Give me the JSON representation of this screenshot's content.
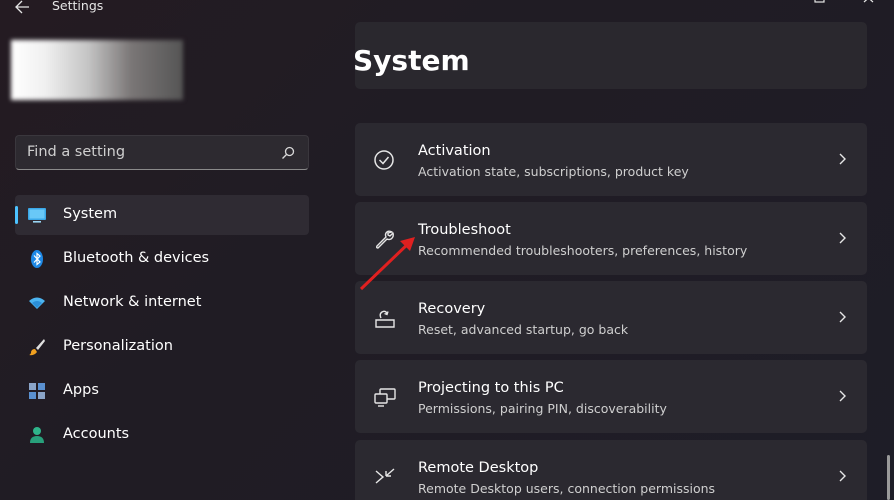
{
  "window": {
    "title": "Settings",
    "back_icon": "arrow-left-icon",
    "controls": [
      "restore-icon",
      "close-icon"
    ]
  },
  "search": {
    "placeholder": "Find a setting",
    "icon": "search-icon"
  },
  "sidebar": {
    "items": [
      {
        "label": "System",
        "icon": "monitor-icon",
        "active": true
      },
      {
        "label": "Bluetooth & devices",
        "icon": "bluetooth-icon"
      },
      {
        "label": "Network & internet",
        "icon": "wifi-icon"
      },
      {
        "label": "Personalization",
        "icon": "brush-icon"
      },
      {
        "label": "Apps",
        "icon": "apps-icon"
      },
      {
        "label": "Accounts",
        "icon": "person-icon"
      }
    ]
  },
  "main": {
    "title": "System",
    "cards": [
      {
        "title": "Activation",
        "desc": "Activation state, subscriptions, product key",
        "icon": "check-circle-icon"
      },
      {
        "title": "Troubleshoot",
        "desc": "Recommended troubleshooters, preferences, history",
        "icon": "wrench-icon"
      },
      {
        "title": "Recovery",
        "desc": "Reset, advanced startup, go back",
        "icon": "recovery-icon"
      },
      {
        "title": "Projecting to this PC",
        "desc": "Permissions, pairing PIN, discoverability",
        "icon": "project-icon"
      },
      {
        "title": "Remote Desktop",
        "desc": "Remote Desktop users, connection permissions",
        "icon": "remote-desktop-icon"
      }
    ]
  },
  "colors": {
    "accent": "#4cc2ff",
    "annotation_arrow": "#e02020"
  }
}
